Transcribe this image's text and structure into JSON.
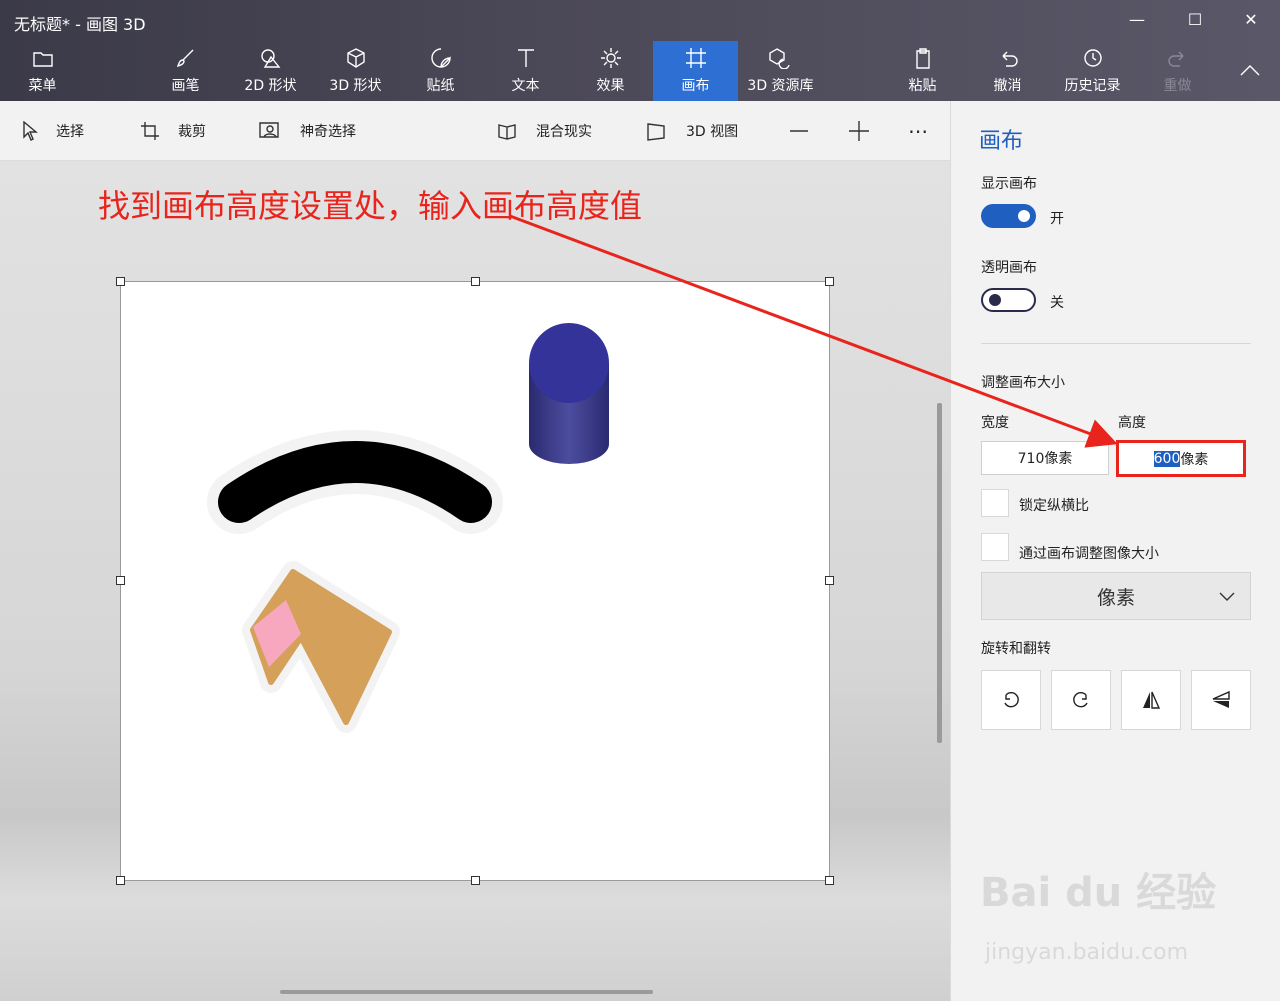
{
  "window": {
    "title": "无标题* - 画图 3D"
  },
  "ribbon": {
    "menu": "菜单",
    "brushes": "画笔",
    "shapes2d": "2D 形状",
    "shapes3d": "3D 形状",
    "stickers": "贴纸",
    "text": "文本",
    "effects": "效果",
    "canvas": "画布",
    "library3d": "3D 资源库",
    "paste": "粘贴",
    "undo": "撤消",
    "history": "历史记录",
    "redo": "重做"
  },
  "toolbar": {
    "select": "选择",
    "crop": "裁剪",
    "magic_select": "神奇选择",
    "mixed_reality": "混合现实",
    "view3d": "3D 视图"
  },
  "annotation": "找到画布高度设置处，输入画布高度值",
  "panel": {
    "title": "画布",
    "show_canvas_label": "显示画布",
    "show_canvas_state": "开",
    "transparent_label": "透明画布",
    "transparent_state": "关",
    "resize_label": "调整画布大小",
    "width_label": "宽度",
    "height_label": "高度",
    "width_value": "710像素",
    "height_value_selected": "600",
    "height_value_unit": "像素",
    "lock_aspect": "锁定纵横比",
    "resize_image": "通过画布调整图像大小",
    "unit_dropdown": "像素",
    "rotate_flip_label": "旋转和翻转"
  },
  "watermark": {
    "logo": "Bai du 经验",
    "url": "jingyan.baidu.com"
  },
  "colors": {
    "accent": "#1f5fbf",
    "annotation_red": "#e8241c",
    "ribbon_active": "#2d6fd2"
  }
}
